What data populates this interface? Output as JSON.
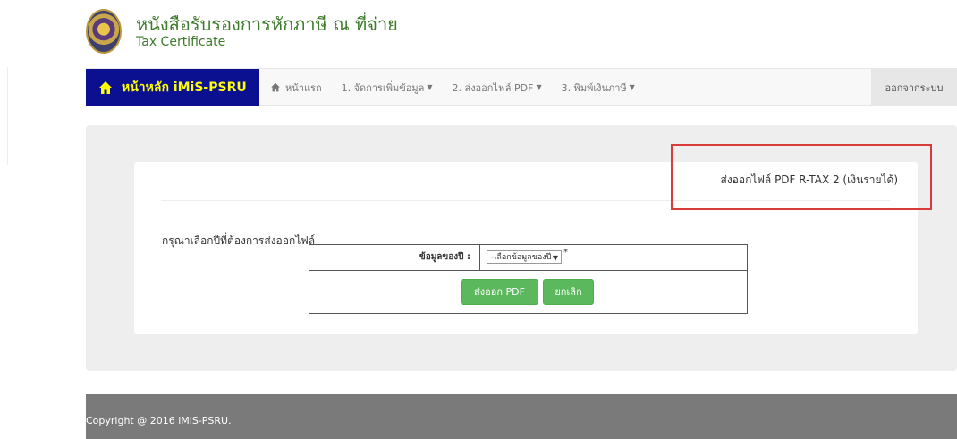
{
  "header": {
    "title_th": "หนังสือรับรองการหักภาษี ณ ที่จ่าย",
    "title_en": "Tax Certificate",
    "logo_icon": "university-seal-logo"
  },
  "navbar": {
    "brand_label": "หน้าหลัก iMiS-PSRU",
    "brand_icon": "home-icon",
    "items": [
      {
        "label": "หน้าแรก",
        "icon": "home-icon"
      },
      {
        "label": "1. จัดการเพิ่มข้อมูล"
      },
      {
        "label": "2. ส่งออกไฟล์ PDF"
      },
      {
        "label": "3. พิมพ์เงินภาษี"
      }
    ],
    "logout_label": "ออกจากระบบ",
    "colors": {
      "brand_bg": "#0a1090",
      "brand_text": "#ffff00"
    }
  },
  "panel": {
    "title": "ส่งออกไฟล์ PDF R-TAX 2 (เงินรายได้)",
    "prompt": "กรุณาเลือกปีที่ต้องการส่งออกไฟล์",
    "form": {
      "year_label": "ข้อมูลของปี :",
      "year_select_value": "-เลือกข้อมูลของปี-",
      "required_mark": "*",
      "export_button": "ส่งออก PDF",
      "cancel_button": "ยกเลิก"
    },
    "highlight_color": "#d93a3a",
    "button_color": "#5cb85c"
  },
  "footer": {
    "text": "Copyright @ 2016 iMiS-PSRU."
  }
}
